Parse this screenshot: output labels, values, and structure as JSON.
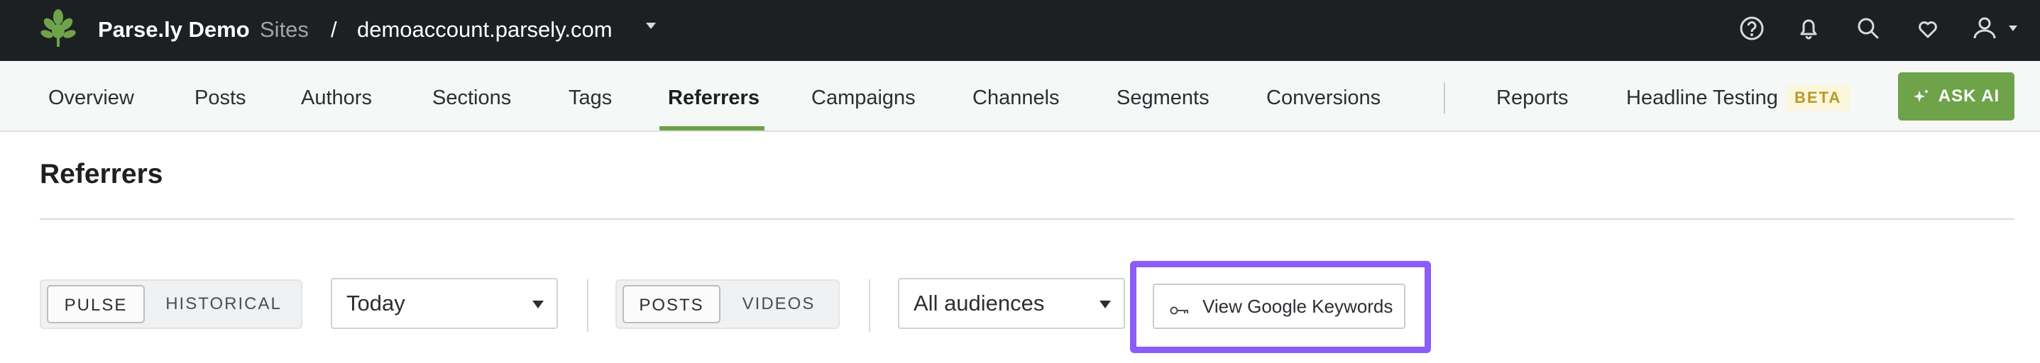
{
  "header": {
    "brand": "Parse.ly Demo",
    "sites_label": "Sites",
    "separator": "/",
    "domain": "demoaccount.parsely.com",
    "icons": [
      "help-icon",
      "bell-icon",
      "search-icon",
      "heart-icon",
      "user-icon"
    ]
  },
  "nav": {
    "tabs": [
      {
        "label": "Overview"
      },
      {
        "label": "Posts"
      },
      {
        "label": "Authors"
      },
      {
        "label": "Sections"
      },
      {
        "label": "Tags"
      },
      {
        "label": "Referrers",
        "active": true
      },
      {
        "label": "Campaigns"
      },
      {
        "label": "Channels"
      },
      {
        "label": "Segments"
      },
      {
        "label": "Conversions"
      },
      {
        "label": "Reports"
      },
      {
        "label": "Headline Testing"
      }
    ],
    "beta_badge": "BETA",
    "ask_ai_label": "ASK AI"
  },
  "page": {
    "title": "Referrers"
  },
  "filters": {
    "mode": {
      "options": [
        "PULSE",
        "HISTORICAL"
      ],
      "selected": "PULSE"
    },
    "period": {
      "value": "Today"
    },
    "content_type": {
      "options": [
        "POSTS",
        "VIDEOS"
      ],
      "selected": "POSTS"
    },
    "audience": {
      "value": "All audiences"
    },
    "google_keywords_label": "View Google Keywords"
  },
  "colors": {
    "header_bg": "#1d2023",
    "accent_green": "#6aa243",
    "highlight_purple": "#8b5cf6"
  }
}
